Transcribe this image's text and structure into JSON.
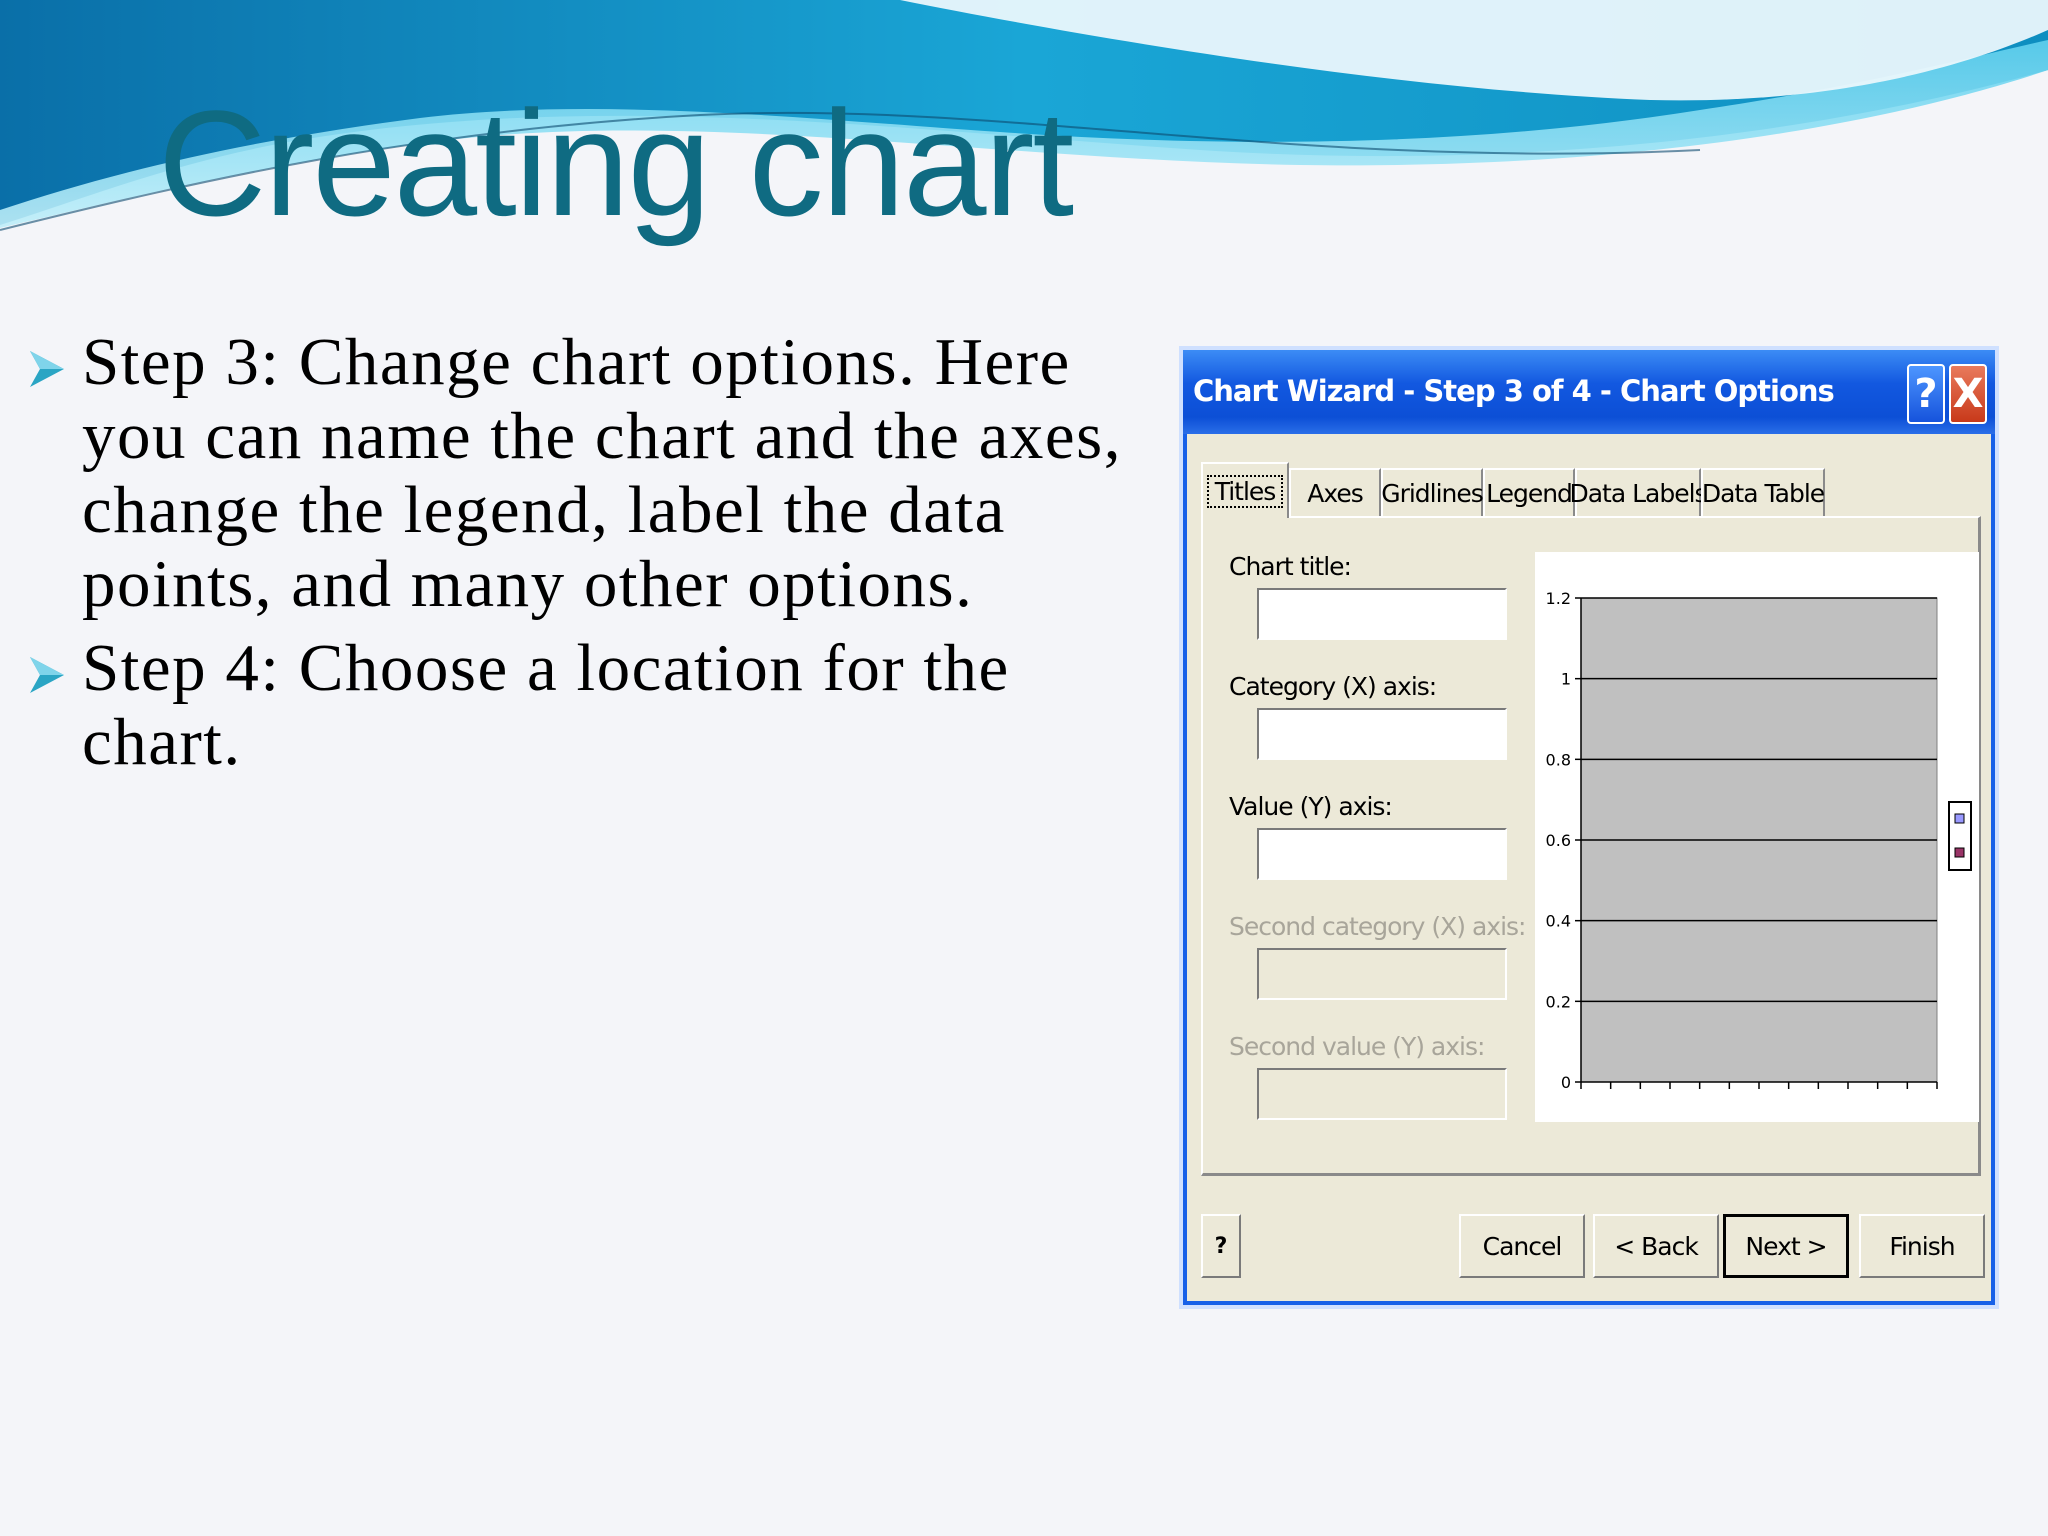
{
  "slide": {
    "title": "Creating chart",
    "bullets": [
      "Step 3: Change chart options.  Here you can name the chart and the axes, change the legend, label the data points, and many other options.",
      "Step 4: Choose a location for the chart."
    ]
  },
  "dialog": {
    "title": "Chart Wizard - Step 3 of 4 - Chart Options",
    "help_glyph": "?",
    "close_glyph": "X",
    "tabs": [
      "Titles",
      "Axes",
      "Gridlines",
      "Legend",
      "Data Labels",
      "Data Table"
    ],
    "active_tab": "Titles",
    "fields": [
      {
        "label": "Chart title:",
        "value": "",
        "enabled": true
      },
      {
        "label": "Category (X) axis:",
        "value": "",
        "enabled": true
      },
      {
        "label": "Value (Y) axis:",
        "value": "",
        "enabled": true
      },
      {
        "label": "Second category (X) axis:",
        "value": "",
        "enabled": false
      },
      {
        "label": "Second value (Y) axis:",
        "value": "",
        "enabled": false
      }
    ],
    "buttons": {
      "help": "?",
      "cancel": "Cancel",
      "back": "< Back",
      "next": "Next >",
      "finish": "Finish"
    }
  },
  "chart_data": {
    "type": "bar",
    "title": "",
    "xlabel": "",
    "ylabel": "",
    "ylim": [
      0,
      1.2
    ],
    "y_ticks": [
      "0",
      "0.2",
      "0.4",
      "0.6",
      "0.8",
      "1",
      "1.2"
    ],
    "x_tick_count": 12,
    "series": [],
    "grid": true,
    "plot_area_color": "#c0c0c0",
    "legend": "right"
  },
  "colors": {
    "title": "#0f6b82",
    "titlebar": "#0c4fd6",
    "dialog_face": "#ece9d8",
    "bullet_arrow": "#2aa5c4"
  }
}
